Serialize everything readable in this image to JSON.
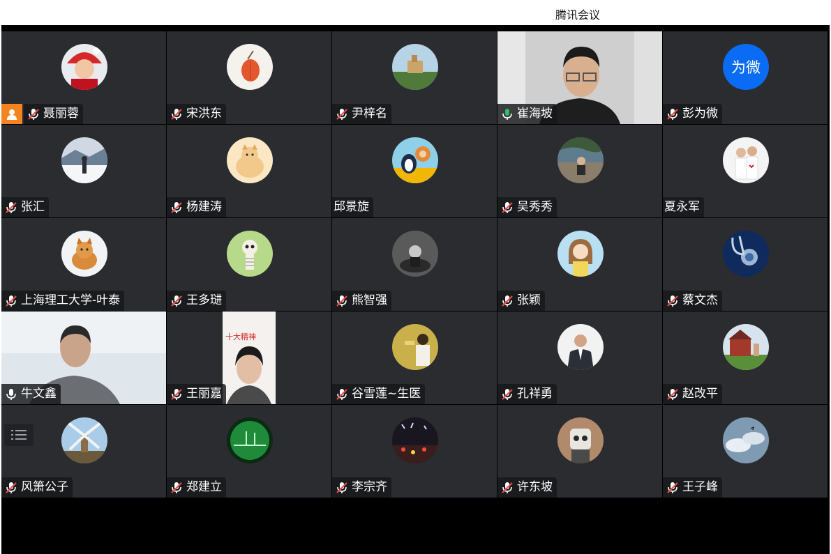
{
  "app": {
    "title": "腾讯会议"
  },
  "participants": [
    {
      "name": "聂丽蓉",
      "mic": "muted",
      "host": true,
      "avatar": "santa-child"
    },
    {
      "name": "宋洪东",
      "mic": "muted",
      "avatar": "lantern-fruit"
    },
    {
      "name": "尹梓名",
      "mic": "muted",
      "avatar": "castle-landscape"
    },
    {
      "name": "崔海坡",
      "mic": "on",
      "video": true,
      "speaking": true
    },
    {
      "name": "彭为微",
      "mic": "muted",
      "avatar_text": "为微"
    },
    {
      "name": "张汇",
      "mic": "muted",
      "avatar": "snow-person"
    },
    {
      "name": "杨建涛",
      "mic": "muted",
      "avatar": "shiba-dog"
    },
    {
      "name": "邱景旋",
      "mic": "none",
      "avatar": "penguin-cartoon"
    },
    {
      "name": "吴秀秀",
      "mic": "muted",
      "avatar": "seaside-girl"
    },
    {
      "name": "夏永军",
      "mic": "none",
      "avatar": "couple-photo"
    },
    {
      "name": "上海理工大学-叶泰",
      "mic": "muted",
      "avatar": "ginger-cat"
    },
    {
      "name": "王多琎",
      "mic": "muted",
      "avatar": "skeleton-cartoon"
    },
    {
      "name": "熊智强",
      "mic": "muted",
      "avatar": "bw-child"
    },
    {
      "name": "张颖",
      "mic": "muted",
      "avatar": "cartoon-girl"
    },
    {
      "name": "蔡文杰",
      "mic": "muted",
      "avatar": "stethoscope"
    },
    {
      "name": "牛文鑫",
      "mic": "on",
      "video": true
    },
    {
      "name": "王丽嘉",
      "mic": "muted",
      "video": true,
      "video_text": "十大精神"
    },
    {
      "name": "谷雪莲~生医",
      "mic": "muted",
      "avatar": "yellow-singer"
    },
    {
      "name": "孔祥勇",
      "mic": "muted",
      "avatar": "suit-man"
    },
    {
      "name": "赵改平",
      "mic": "muted",
      "avatar": "red-house"
    },
    {
      "name": "风箫公子",
      "mic": "muted",
      "avatar": "windmill"
    },
    {
      "name": "郑建立",
      "mic": "muted",
      "avatar": "green-monitor"
    },
    {
      "name": "李宗齐",
      "mic": "muted",
      "avatar": "night-lights"
    },
    {
      "name": "许东坡",
      "mic": "muted",
      "avatar": "robot-face"
    },
    {
      "name": "王子峰",
      "mic": "muted",
      "avatar": "sky-clouds"
    }
  ],
  "colors": {
    "tile": "#2a2c30",
    "stage": "#000000",
    "speaking": "#2dbf6a",
    "host": "#f5841f",
    "avatar_text_bg": "#0a6cf5",
    "mic_muted": "#e64c4c"
  }
}
